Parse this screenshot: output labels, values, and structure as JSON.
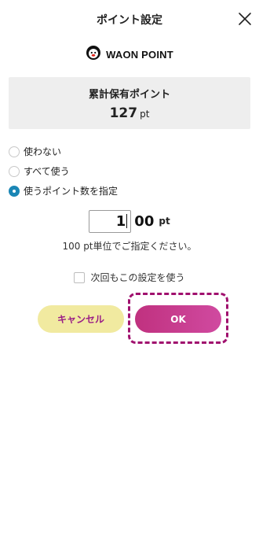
{
  "header": {
    "title": "ポイント設定",
    "close_icon": "close-icon"
  },
  "brand": {
    "logo_icon": "waon-dog-icon",
    "name": "WAON POINT"
  },
  "points": {
    "label": "累計保有ポイント",
    "value": "127",
    "unit": "pt"
  },
  "options": [
    {
      "label": "使わない",
      "selected": false
    },
    {
      "label": "すべて使う",
      "selected": false
    },
    {
      "label": "使うポイント数を指定",
      "selected": true
    }
  ],
  "amount": {
    "input_value": "1",
    "suffix": "00",
    "unit": "pt"
  },
  "hint": "100 pt単位でご指定ください。",
  "remember": {
    "label": "次回もこの設定を使う",
    "checked": false
  },
  "buttons": {
    "cancel": "キャンセル",
    "ok": "OK"
  },
  "colors": {
    "accent": "#c0317f",
    "cancel_bg": "#f1eaa0",
    "radio_selected": "#1a86b5",
    "highlight": "#a0106e"
  }
}
